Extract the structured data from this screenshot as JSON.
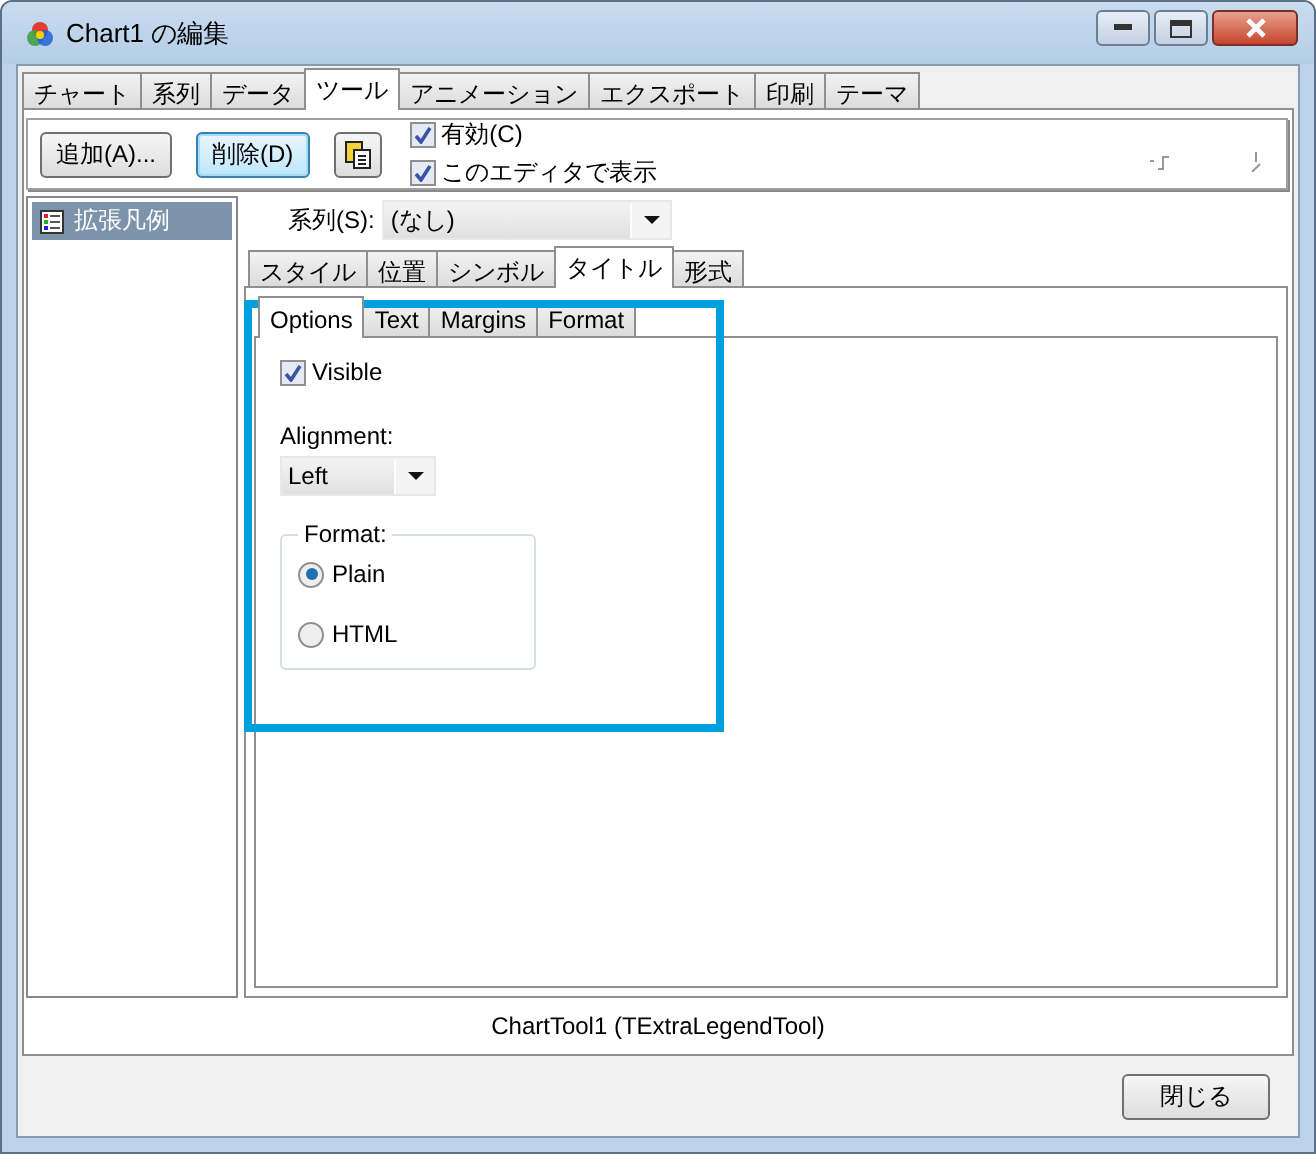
{
  "window": {
    "title": "Chart1 の編集"
  },
  "tabs": [
    {
      "label": "チャート",
      "selected": false
    },
    {
      "label": "系列",
      "selected": false
    },
    {
      "label": "データ",
      "selected": false
    },
    {
      "label": "ツール",
      "selected": true
    },
    {
      "label": "アニメーション",
      "selected": false
    },
    {
      "label": "エクスポート",
      "selected": false
    },
    {
      "label": "印刷",
      "selected": false
    },
    {
      "label": "テーマ",
      "selected": false
    }
  ],
  "toolbar": {
    "buttons": [
      {
        "label": "追加(A)...",
        "focused": false
      },
      {
        "label": "削除(D)",
        "focused": true
      }
    ],
    "checkboxes": [
      {
        "label": "有効(C)",
        "checked": true
      },
      {
        "label": "このエディタで表示",
        "checked": true
      }
    ]
  },
  "tools_list": {
    "items": [
      {
        "label": "拡張凡例",
        "selected": true
      }
    ]
  },
  "series": {
    "label": "系列(S):",
    "value": "(なし)"
  },
  "property_tabs": [
    {
      "label": "スタイル",
      "selected": false
    },
    {
      "label": "位置",
      "selected": false
    },
    {
      "label": "シンボル",
      "selected": false
    },
    {
      "label": "タイトル",
      "selected": true
    },
    {
      "label": "形式",
      "selected": false
    }
  ],
  "title_tabs": [
    {
      "label": "Options",
      "selected": true
    },
    {
      "label": "Text",
      "selected": false
    },
    {
      "label": "Margins",
      "selected": false
    },
    {
      "label": "Format",
      "selected": false
    }
  ],
  "visible": {
    "label": "Visible",
    "checked": true
  },
  "alignment": {
    "label": "Alignment:",
    "value": "Left"
  },
  "format_group": {
    "title": "Format:",
    "options": [
      {
        "label": "Plain",
        "selected": true
      },
      {
        "label": "HTML",
        "selected": false
      }
    ]
  },
  "status": "ChartTool1 (TExtraLegendTool)",
  "close_button": "閉じる"
}
